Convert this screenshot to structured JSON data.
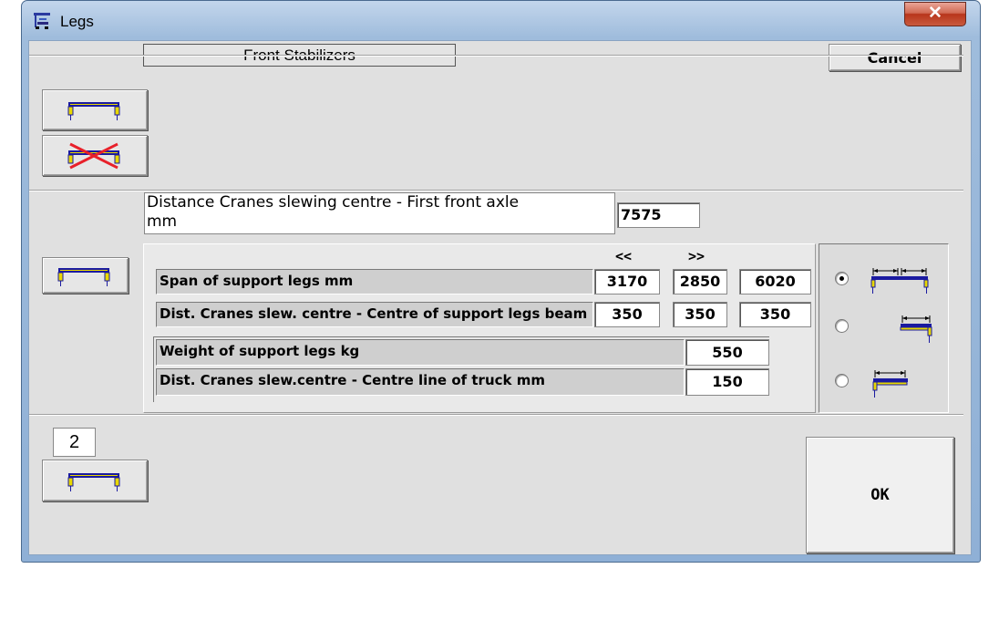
{
  "window": {
    "title": "Legs",
    "close_glyph": "✕"
  },
  "header": {
    "section_title": "Front Stabilizers",
    "cancel_label": "Cancel"
  },
  "distance": {
    "label_line1": "Distance  Cranes slewing centre - First front axle",
    "label_line2": " mm",
    "value": "7575"
  },
  "table": {
    "arrow_left": "<<",
    "arrow_right": ">>",
    "rows": [
      {
        "label": "Span of support legs       mm",
        "values": [
          "3170",
          "2850",
          "6020"
        ]
      },
      {
        "label": "Dist. Cranes slew. centre - Centre of support legs beam",
        "values": [
          "350",
          "350",
          "350"
        ]
      }
    ],
    "weight_label": "Weight of support legs  kg",
    "weight_value": "550",
    "truck_label": "Dist. Cranes slew.centre - Centre line of truck  mm",
    "truck_value": "150"
  },
  "radio": {
    "selected_index": 0,
    "options": [
      "span-full-icon",
      "span-right-icon",
      "span-left-icon"
    ]
  },
  "bottom": {
    "count": "2",
    "ok_label": "OK"
  },
  "colors": {
    "leg_blue": "#1a1aa0",
    "leg_yellow": "#e8d800",
    "cross_red": "#e8202a"
  }
}
